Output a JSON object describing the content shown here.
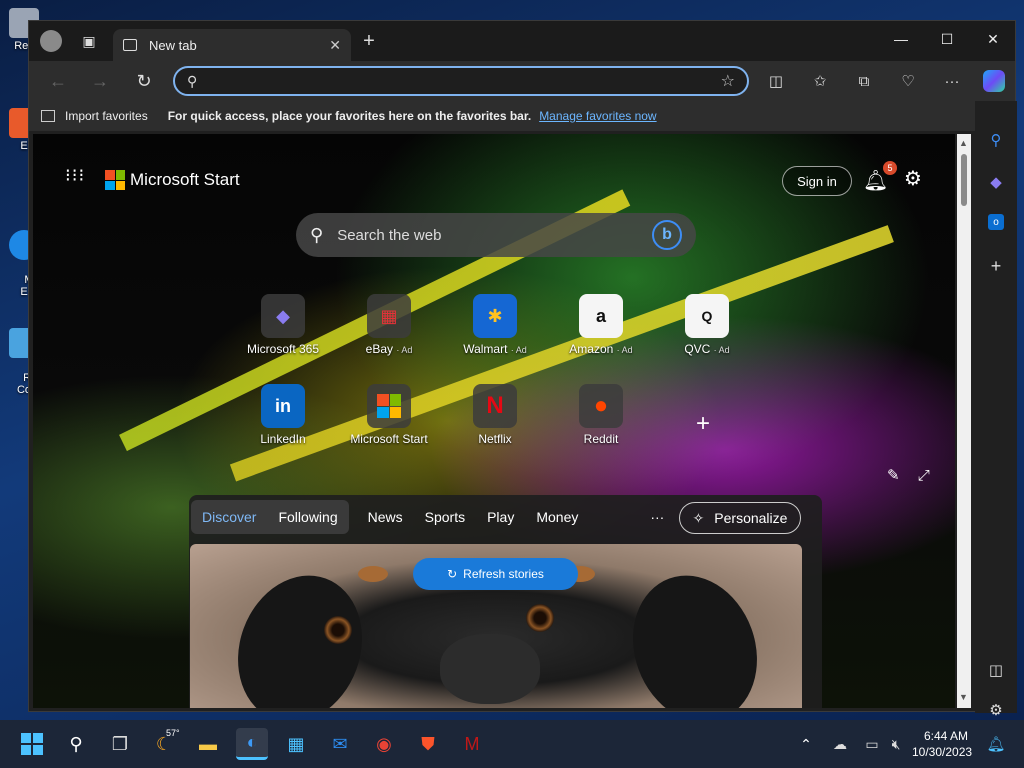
{
  "desktop": {
    "icons": [
      {
        "label": "Rec",
        "color": "#9aa4b4"
      },
      {
        "label": "E",
        "color": "#e85a2b"
      },
      {
        "label": "Mi\nE",
        "color": "#1e88e5"
      },
      {
        "label": "Re\nCo",
        "color": "#4aa3df"
      }
    ]
  },
  "browser": {
    "tab": {
      "title": "New tab",
      "close": "✕"
    },
    "window_controls": {
      "minimize": "—",
      "maximize": "☐",
      "close": "✕"
    },
    "new_tab": "+",
    "address": {
      "value": "",
      "placeholder": ""
    },
    "favorites_bar": {
      "import_label": "Import favorites",
      "hint": "For quick access, place your favorites here on the favorites bar.",
      "manage_link": "Manage favorites now"
    }
  },
  "start": {
    "brand": "Microsoft Start",
    "sign_in": "Sign in",
    "notifications_count": "5",
    "search_placeholder": "Search the web",
    "bing_glyph": "b",
    "tiles": [
      {
        "label": "Microsoft 365",
        "ad": "",
        "glyph": "◆",
        "color": "#8a7cf0"
      },
      {
        "label": "eBay",
        "ad": "· Ad",
        "glyph": "▦",
        "color": "#e53238"
      },
      {
        "label": "Walmart",
        "ad": "· Ad",
        "glyph": "✱",
        "color": "#ffc220"
      },
      {
        "label": "Amazon",
        "ad": "· Ad",
        "glyph": "a",
        "color": "#ffffff"
      },
      {
        "label": "QVC",
        "ad": "· Ad",
        "glyph": "Q",
        "color": "#ffffff"
      },
      {
        "label": "LinkedIn",
        "ad": "",
        "glyph": "in",
        "color": "#0a66c2"
      },
      {
        "label": "Microsoft Start",
        "ad": "",
        "glyph": "▦",
        "color": "#f25022"
      },
      {
        "label": "Netflix",
        "ad": "",
        "glyph": "N",
        "color": "#e50914"
      },
      {
        "label": "Reddit",
        "ad": "",
        "glyph": "●",
        "color": "#ff4500"
      }
    ],
    "add_site": "+",
    "feed": {
      "tabs": [
        "Discover",
        "Following",
        "News",
        "Sports",
        "Play",
        "Money"
      ],
      "more": "···",
      "personalize": "Personalize",
      "refresh": "Refresh stories"
    }
  },
  "taskbar": {
    "weather_temp": "57°",
    "time": "6:44 AM",
    "date": "10/30/2023"
  }
}
